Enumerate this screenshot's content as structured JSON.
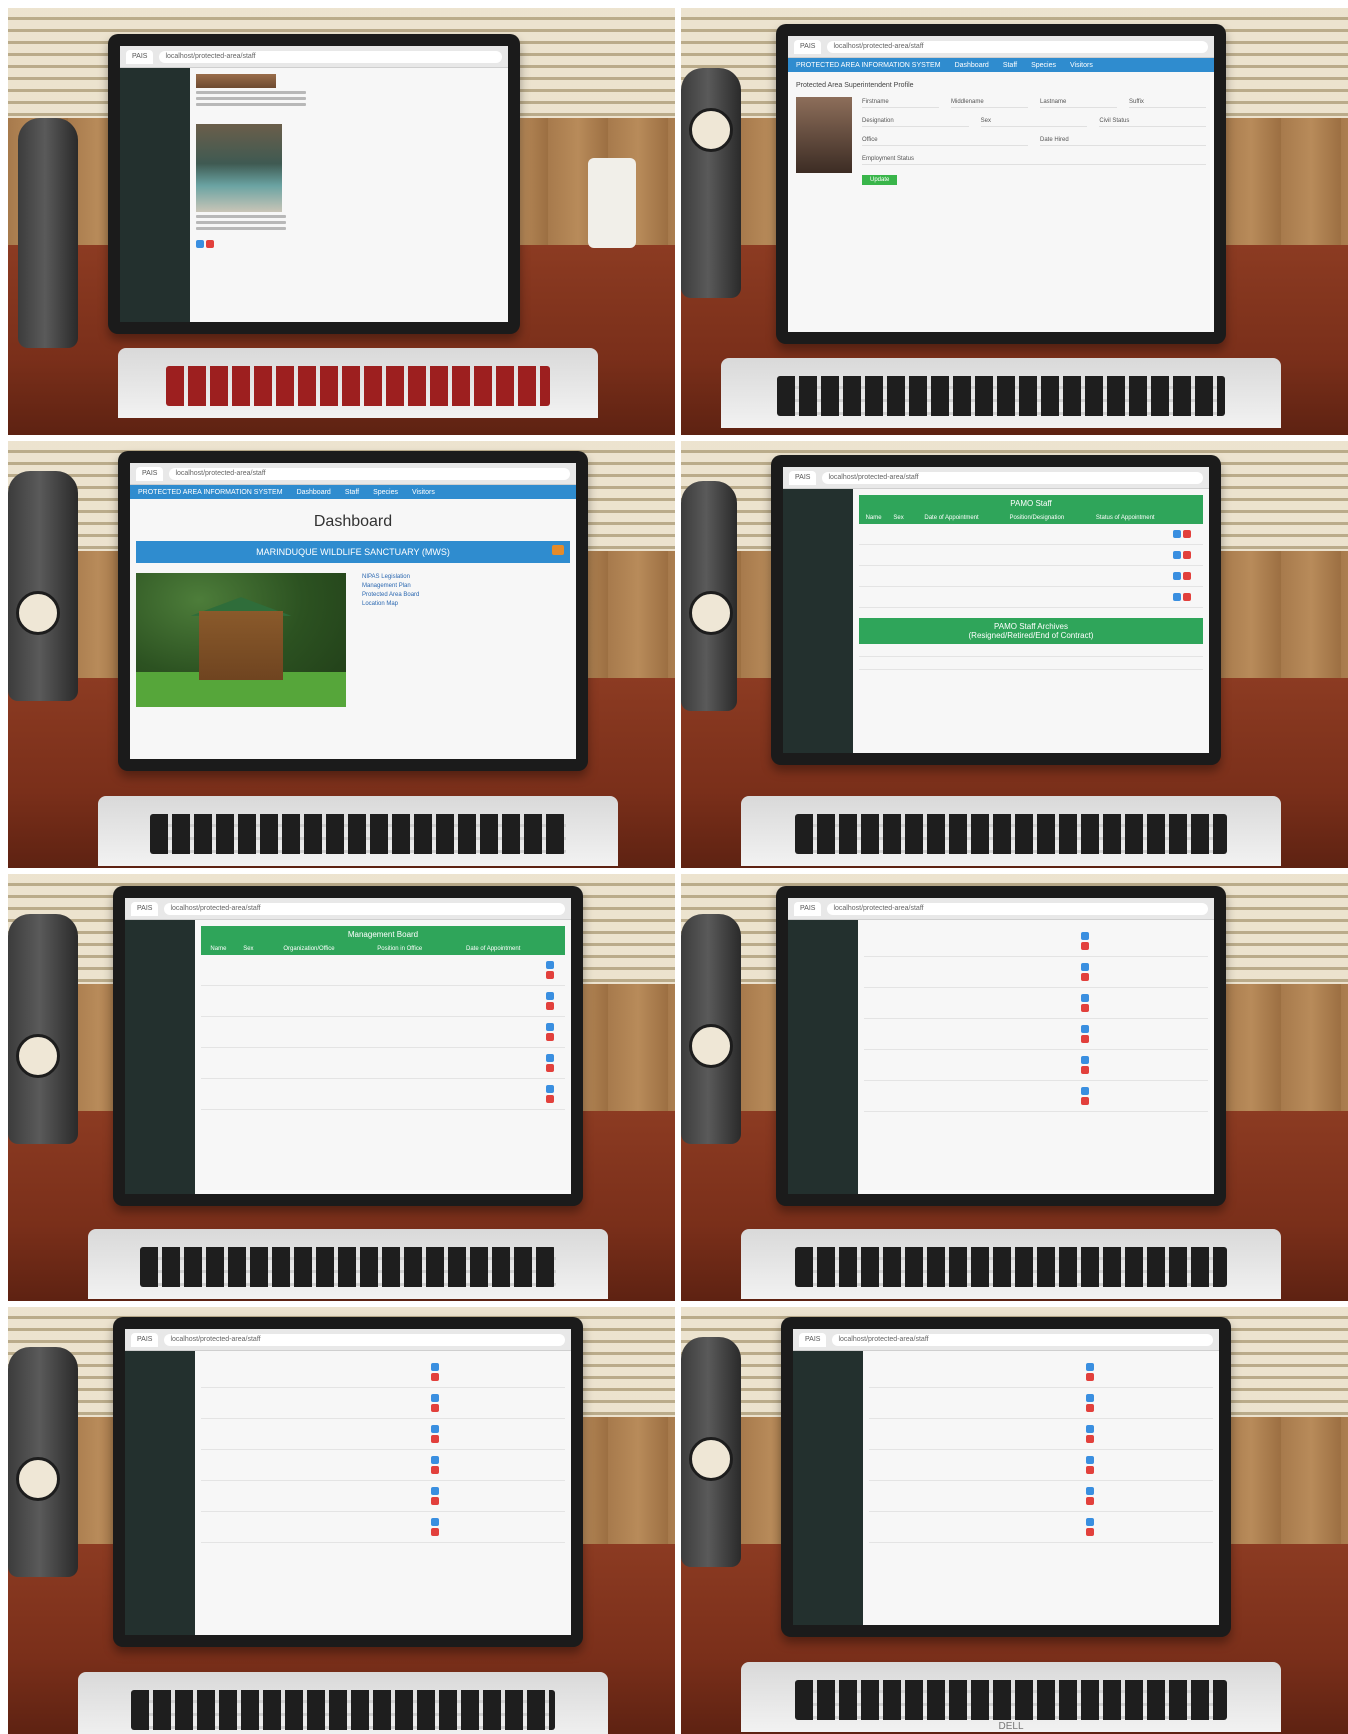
{
  "browser": {
    "url_text": "localhost/protected-area/staff",
    "tab_label": "PAIS"
  },
  "app": {
    "title": "PROTECTED AREA INFORMATION SYSTEM",
    "nav": [
      "Dashboard",
      "Staff",
      "Species",
      "Visitors"
    ]
  },
  "dashboard": {
    "title": "Dashboard",
    "banner": "MARINDUQUE WILDLIFE SANCTUARY (MWS)",
    "links": [
      "NIPAS Legislation",
      "Management Plan",
      "Protected Area Board",
      "Location Map"
    ]
  },
  "staff_profile": {
    "heading": "Protected Area Superintendent Profile",
    "fields": [
      "Firstname",
      "Middlename",
      "Lastname",
      "Suffix",
      "Designation",
      "Sex",
      "Civil Status",
      "Office",
      "Date Hired",
      "Employment Status"
    ],
    "button": "Update"
  },
  "pamo_staff": {
    "title": "PAMO Staff",
    "columns": [
      "Name",
      "Sex",
      "Date of Appointment",
      "Position/Designation",
      "Status of Appointment"
    ],
    "archive_title": "PAMO Staff Archives",
    "archive_subtitle": "(Resigned/Retired/End of Contract)"
  },
  "management_board": {
    "title": "Management Board",
    "columns": [
      "Name",
      "Sex",
      "Organization/Office",
      "Position in Office",
      "Date of Appointment"
    ]
  },
  "colors": {
    "accent_blue": "#2f8ccf",
    "table_green": "#2fa55a",
    "sidebar_dark": "#23302e",
    "edit_button": "#3a8fe0",
    "delete_button": "#e2403c"
  },
  "laptop_brand": "DELL",
  "icons": [
    "edit-icon",
    "delete-icon",
    "tab-icon"
  ]
}
